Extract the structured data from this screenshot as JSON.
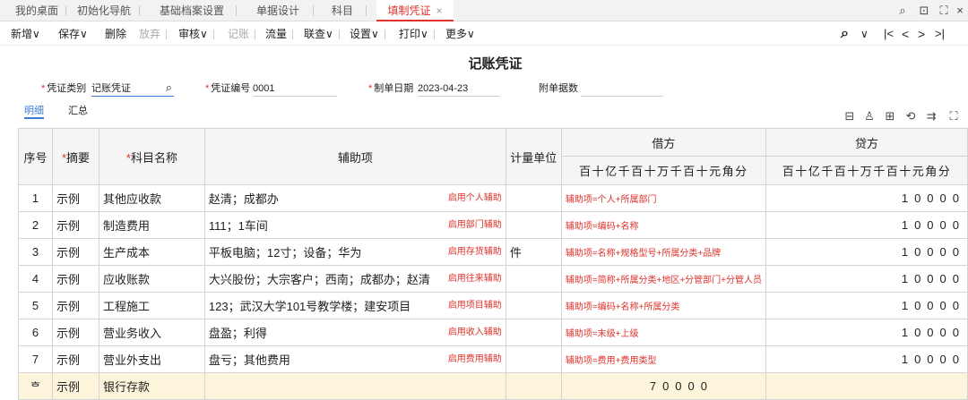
{
  "tabs": [
    {
      "label": "我的桌面"
    },
    {
      "label": "初始化导航"
    },
    {
      "label": "基础档案设置"
    },
    {
      "label": "单据设计"
    },
    {
      "label": "科目"
    },
    {
      "label": "填制凭证",
      "close": "×"
    }
  ],
  "window_controls": {
    "search": "⌕",
    "restore": "⊡",
    "maximize": "⛶",
    "close": "×"
  },
  "toolbar": {
    "add": "新增∨",
    "save": "保存∨",
    "delete": "删除",
    "discard": "放弃",
    "review": "审核∨",
    "post": "记账",
    "flow": "流量",
    "check": "联查∨",
    "settings": "设置∨",
    "print": "打印∨",
    "more": "更多∨"
  },
  "nav": {
    "search_icon": "⌕",
    "dropdown": "∨",
    "first": "|<",
    "prev": "<",
    "next": ">",
    "last": ">|"
  },
  "voucher": {
    "title": "记账凭证",
    "type_label": "凭证类别",
    "type_value": "记账凭证",
    "no_label": "凭证编号",
    "no_value": "0001",
    "date_label": "制单日期",
    "date_value": "2023-04-23",
    "attach_label": "附单据数",
    "attach_value": ""
  },
  "subtabs": {
    "detail": "明细",
    "summary": "汇总"
  },
  "table": {
    "headers": {
      "seq": "序号",
      "summary": "摘要",
      "account": "科目名称",
      "aux": "辅助项",
      "unit": "计量单位",
      "debit": "借方",
      "credit": "贷方"
    },
    "digits": "百十亿千百十万千百十元角分",
    "rows": [
      {
        "seq": "1",
        "summary": "示例",
        "account": "其他应收款",
        "aux": "赵清；成都办",
        "aux_tag": "启用个人辅助",
        "unit": "",
        "note": "辅助项=个人+所属部门",
        "credit": "10000"
      },
      {
        "seq": "2",
        "summary": "示例",
        "account": "制造费用",
        "aux": "111；1车间",
        "aux_tag": "启用部门辅助",
        "unit": "",
        "note": "辅助项=编码+名称",
        "credit": "10000"
      },
      {
        "seq": "3",
        "summary": "示例",
        "account": "生产成本",
        "aux": "平板电脑；12寸；设备；华为",
        "aux_tag": "启用存货辅助",
        "unit": "件",
        "note": "辅助项=名称+规格型号+所属分类+品牌",
        "credit": "10000"
      },
      {
        "seq": "4",
        "summary": "示例",
        "account": "应收账款",
        "aux": "大兴股份；大宗客户；西南；成都办；赵清",
        "aux_tag": "启用往来辅助",
        "unit": "",
        "note": "辅助项=简称+所属分类+地区+分管部门+分管人员",
        "credit": "10000"
      },
      {
        "seq": "5",
        "summary": "示例",
        "account": "工程施工",
        "aux": "123；武汉大学101号教学楼；建安项目",
        "aux_tag": "启用项目辅助",
        "unit": "",
        "note": "辅助项=编码+名称+所属分类",
        "credit": "10000"
      },
      {
        "seq": "6",
        "summary": "示例",
        "account": "营业务收入",
        "aux": "盘盈；利得",
        "aux_tag": "启用收入辅助",
        "unit": "",
        "note": "辅助项=末级+上级",
        "credit": "10000"
      },
      {
        "seq": "7",
        "summary": "示例",
        "account": "营业外支出",
        "aux": "盘亏；其他费用",
        "aux_tag": "启用费用辅助",
        "unit": "",
        "note": "辅助项=费用+费用类型",
        "credit": "10000"
      },
      {
        "seq": "ᄒ",
        "summary": "示例",
        "account": "银行存款",
        "aux": "",
        "aux_tag": "",
        "unit": "",
        "note": "",
        "debit": "70000",
        "credit": ""
      }
    ]
  },
  "colors": {
    "accent": "#e0322b",
    "link": "#3a7bd5",
    "total_row": "#fcf5dc"
  }
}
